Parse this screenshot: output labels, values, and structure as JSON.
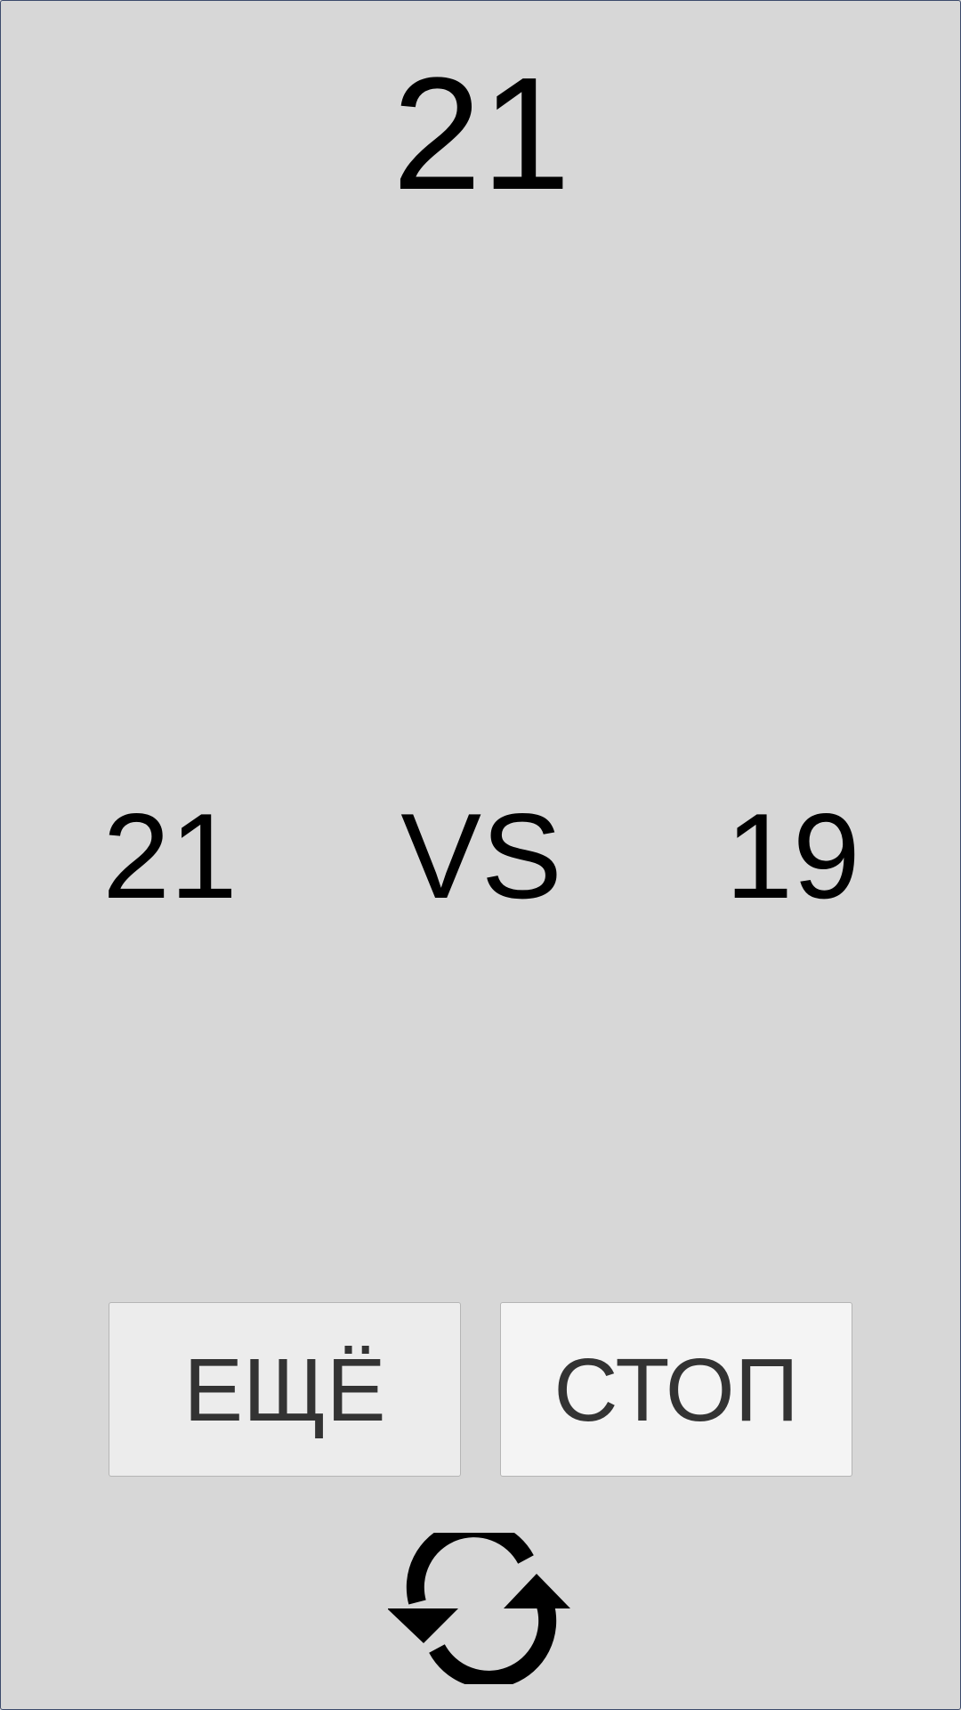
{
  "game": {
    "target_score": "21",
    "player_score": "21",
    "versus_label": "VS",
    "opponent_score": "19"
  },
  "buttons": {
    "more_label": "ЕЩЁ",
    "stop_label": "СТОП"
  },
  "icons": {
    "restart": "refresh-icon"
  },
  "colors": {
    "background": "#d7d7d7",
    "button_more_bg": "#ececec",
    "button_stop_bg": "#f4f4f4",
    "button_text": "#333333",
    "text": "#000000"
  }
}
